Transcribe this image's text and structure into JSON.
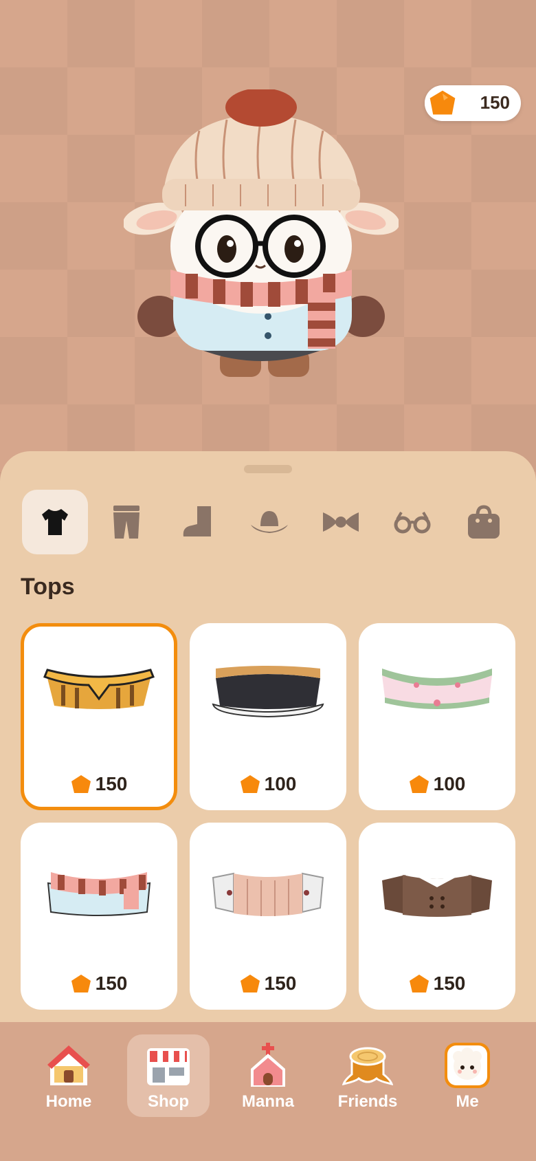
{
  "balance": "150",
  "categories": [
    {
      "name": "tops",
      "icon": "tshirt-icon"
    },
    {
      "name": "bottoms",
      "icon": "pants-icon"
    },
    {
      "name": "shoes",
      "icon": "boot-icon"
    },
    {
      "name": "hats",
      "icon": "hat-icon"
    },
    {
      "name": "bows",
      "icon": "bowtie-icon"
    },
    {
      "name": "glasses",
      "icon": "glasses-icon"
    },
    {
      "name": "bags",
      "icon": "bag-icon"
    }
  ],
  "section_title": "Tops",
  "items": [
    {
      "price": "150",
      "desc": "yellow-striped-collar-top"
    },
    {
      "price": "100",
      "desc": "dark-fur-trim-top"
    },
    {
      "price": "100",
      "desc": "pink-green-frill-top"
    },
    {
      "price": "150",
      "desc": "blue-top-with-striped-scarf"
    },
    {
      "price": "150",
      "desc": "white-jacket-pink-sweater"
    },
    {
      "price": "150",
      "desc": "brown-coat-with-collar"
    }
  ],
  "nav": [
    {
      "label": "Home",
      "icon": "home-icon"
    },
    {
      "label": "Shop",
      "icon": "shop-icon"
    },
    {
      "label": "Manna",
      "icon": "church-icon"
    },
    {
      "label": "Friends",
      "icon": "stump-icon"
    },
    {
      "label": "Me",
      "icon": "sheep-avatar-icon"
    }
  ],
  "colors": {
    "accent": "#f38d0e",
    "panel": "#ebccaa",
    "background": "#d6a68c"
  }
}
